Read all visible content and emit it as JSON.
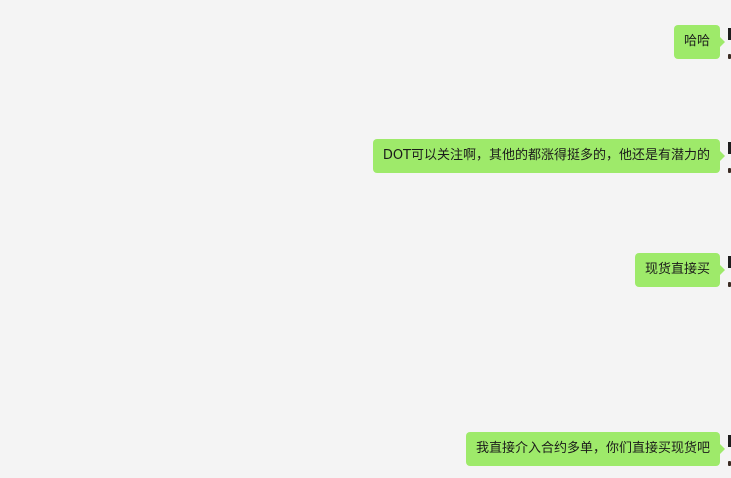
{
  "messages": [
    {
      "text": "哈哈"
    },
    {
      "text": "DOT可以关注啊，其他的都涨得挺多的，他还是有潜力的"
    },
    {
      "text": "现货直接买"
    },
    {
      "text": "我直接介入合约多单，你们直接买现货吧"
    }
  ],
  "colors": {
    "background": "#f4f4f4",
    "bubble_self": "#9eea6a",
    "text": "#1b1b1b"
  }
}
